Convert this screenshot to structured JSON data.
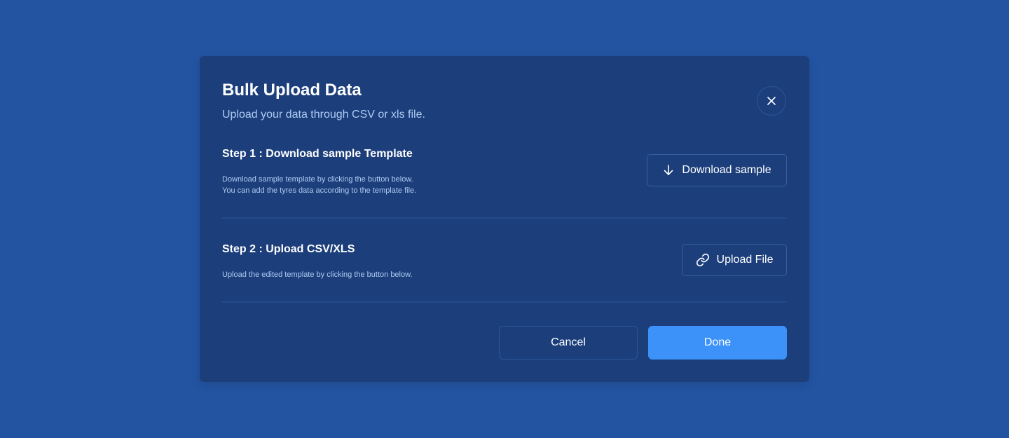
{
  "modal": {
    "title": "Bulk Upload Data",
    "subtitle": "Upload your data through CSV or xls file.",
    "close_icon": "close-icon"
  },
  "steps": [
    {
      "title": "Step 1 : Download sample Template",
      "description": [
        "Download sample template by clicking the button below.",
        "You can add the tyres data according to the template file."
      ],
      "button_label": "Download sample",
      "button_icon": "arrow-down-icon"
    },
    {
      "title": "Step 2 : Upload CSV/XLS",
      "description": [
        "Upload the edited template by clicking the button below."
      ],
      "button_label": "Upload File",
      "button_icon": "link-icon"
    }
  ],
  "footer": {
    "cancel_label": "Cancel",
    "done_label": "Done"
  },
  "colors": {
    "page_background": "#2354a2",
    "modal_background": "#1c3f7c",
    "accent": "#3c92f9",
    "muted_text": "#aecaf1",
    "border": "#335f9f"
  }
}
